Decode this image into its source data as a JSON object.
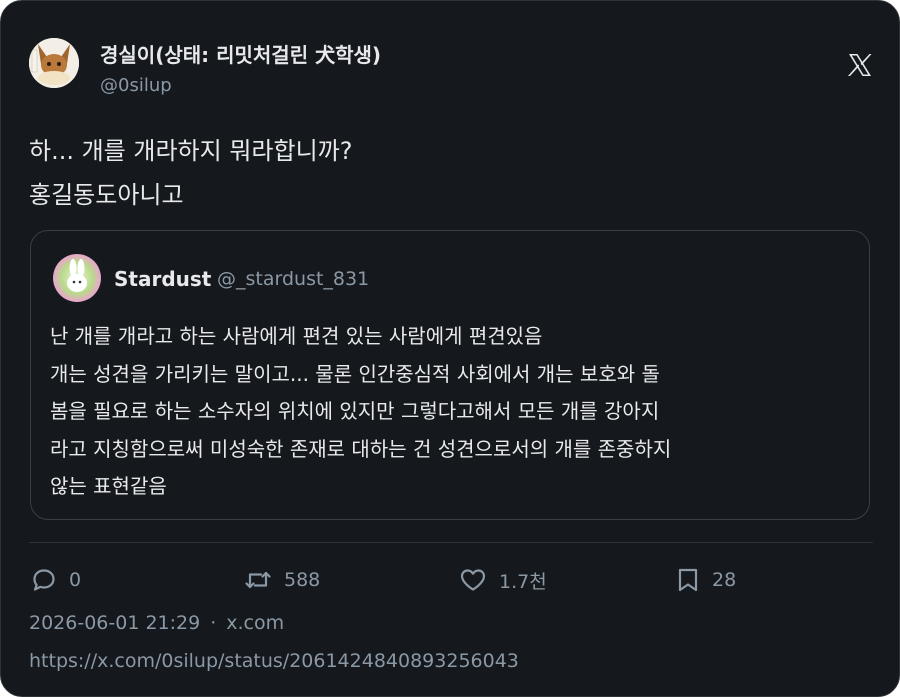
{
  "author": {
    "name": "경실이(상태: 리밋처걸린 犬학생)",
    "handle": "@0silup"
  },
  "tweet": {
    "lines": [
      "하... 개를 개라하지 뭐라합니까?",
      "홍길동도아니고"
    ]
  },
  "quote": {
    "name": "Stardust",
    "handle": "@_stardust_831",
    "lines": [
      "난 개를 개라고 하는 사람에게 편견 있는 사람에게 편견있음",
      "개는 성견을 가리키는 말이고... 물론 인간중심적 사회에서 개는 보호와 돌",
      "봄을 필요로 하는 소수자의 위치에 있지만 그렇다고해서 모든 개를 강아지",
      "라고 지칭함으로써 미성숙한 존재로 대하는 건 성견으로서의 개를 존중하지",
      "않는 표현같음"
    ]
  },
  "actions": {
    "reply_count": "0",
    "retweet_count": "588",
    "like_count": "1.7천",
    "bookmark_count": "28"
  },
  "meta": {
    "timestamp": "2026-06-01 21:29",
    "separator": "·",
    "source": "x.com"
  },
  "url": "https://x.com/0silup/status/2061424840893256043",
  "icons": {
    "brand": "x-logo-icon",
    "reply": "reply-icon",
    "retweet": "retweet-icon",
    "like": "heart-icon",
    "bookmark": "bookmark-icon"
  },
  "colors": {
    "background": "#15181c",
    "text": "#e7e9ea",
    "muted": "#8b98a5",
    "border": "#2f3336"
  }
}
